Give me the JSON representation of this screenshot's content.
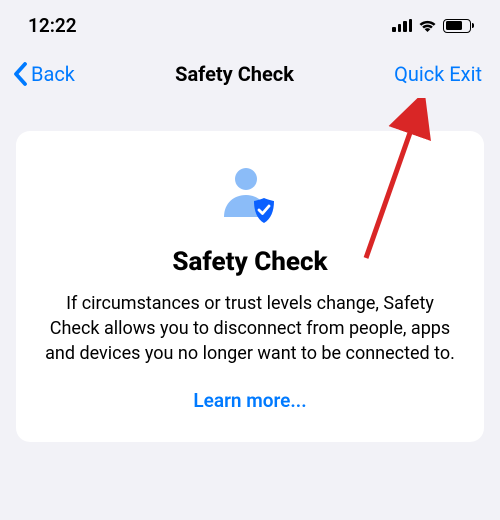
{
  "statusbar": {
    "time": "12:22"
  },
  "nav": {
    "back_label": "Back",
    "title": "Safety Check",
    "quick_exit_label": "Quick Exit"
  },
  "card": {
    "title": "Safety Check",
    "body": "If circumstances or trust levels change, Safety Check allows you to disconnect from people, apps and devices you no longer want to be connected to.",
    "learn_more_label": "Learn more..."
  },
  "colors": {
    "accent": "#007aff",
    "background": "#f2f2f7",
    "icon_light": "#8bbcf8",
    "icon_dark": "#0a60ff",
    "annotation": "#d92626"
  }
}
